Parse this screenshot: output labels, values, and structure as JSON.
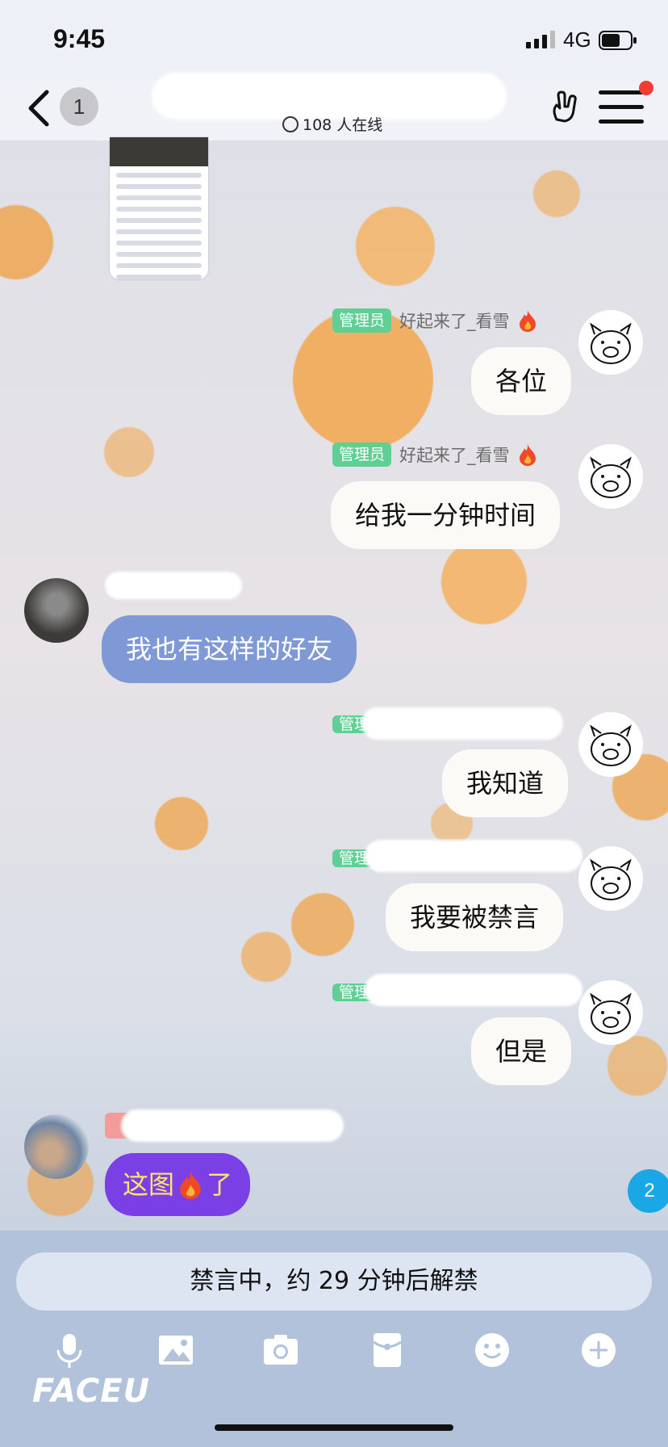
{
  "status_bar": {
    "time": "9:45",
    "network": "4G"
  },
  "header": {
    "back_badge": "1",
    "online_text": "108 人在线"
  },
  "messages": [
    {
      "role_tag": "管理员",
      "sender": "好起来了_看雪",
      "text": "各位"
    },
    {
      "role_tag": "管理员",
      "sender": "好起来了_看雪",
      "text": "给我一分钟时间"
    },
    {
      "text": "我也有这样的好友"
    },
    {
      "role_tag": "管理员",
      "text": "我知道"
    },
    {
      "role_tag": "管理员",
      "text": "我要被禁言"
    },
    {
      "role_tag": "管理员",
      "text": "但是"
    },
    {
      "text_before": "这图",
      "text_after": "了"
    }
  ],
  "unread_count": "2",
  "input_bar": {
    "mute_notice": "禁言中，约 29 分钟后解禁",
    "watermark": "FACEU"
  },
  "icons": [
    "back-arrow-icon",
    "signal-icon",
    "battery-icon",
    "online-dropdown-icon",
    "hand-gesture-icon",
    "menu-icon",
    "fire-icon",
    "microphone-icon",
    "image-icon",
    "camera-icon",
    "red-packet-icon",
    "emoji-icon",
    "plus-icon"
  ],
  "colors": {
    "admin_tag": "#5fcf94",
    "bubble_blue": "#7e99d5",
    "bubble_purple": "#7a40e6",
    "unread_badge": "#1aa7e6",
    "notify_dot": "#f23c35"
  }
}
